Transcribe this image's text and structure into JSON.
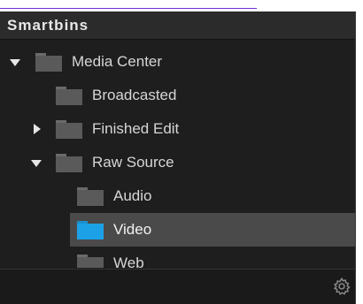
{
  "panel": {
    "title": "Smartbins"
  },
  "tree": {
    "items": [
      {
        "label": "Media Center",
        "level": 0,
        "expander": "expanded",
        "folder_color": "#5a5a5a"
      },
      {
        "label": "Broadcasted",
        "level": 1,
        "expander": "none",
        "folder_color": "#5a5a5a"
      },
      {
        "label": "Finished Edit",
        "level": 1,
        "expander": "collapsed",
        "folder_color": "#5a5a5a"
      },
      {
        "label": "Raw Source",
        "level": 1,
        "expander": "expanded",
        "folder_color": "#5a5a5a"
      },
      {
        "label": "Audio",
        "level": 2,
        "expander": "none",
        "folder_color": "#5a5a5a"
      },
      {
        "label": "Video",
        "level": 2,
        "expander": "none",
        "folder_color": "#1da1e6",
        "selected": true
      },
      {
        "label": "Web",
        "level": 2,
        "expander": "none",
        "folder_color": "#5a5a5a"
      }
    ]
  },
  "footer": {
    "settings_icon": "gear-icon"
  },
  "colors": {
    "panel_bg": "#1e1e1e",
    "header_bg": "#2b2b2b",
    "selection_bg": "#4a4a4a",
    "accent_folder": "#1da1e6",
    "top_rule": "#7b2bd9"
  }
}
